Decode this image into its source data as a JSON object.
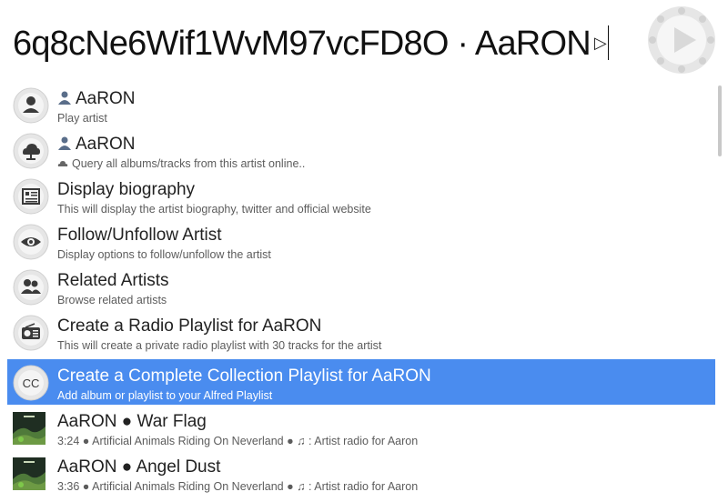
{
  "query": {
    "text": "6q8cNe6Wif1WvM97vcFD8O · AaRON",
    "arrow": "▷"
  },
  "app_logo": "alfred-hat-logo",
  "results": [
    {
      "icon": "person-icon",
      "title": "AaRON",
      "title_icon": "person-mini-icon",
      "subtitle": "Play artist"
    },
    {
      "icon": "cloud-person-icon",
      "title": "AaRON",
      "title_icon": "person-mini-icon",
      "subtitle": "Query all albums/tracks from this artist online..",
      "subtitle_icon": "cloud-mini-icon"
    },
    {
      "icon": "biography-icon",
      "title": "Display biography",
      "subtitle": "This will display the artist biography, twitter and official website"
    },
    {
      "icon": "eye-icon",
      "title": "Follow/Unfollow Artist",
      "subtitle": "Display options to follow/unfollow the artist"
    },
    {
      "icon": "people-icon",
      "title": "Related Artists",
      "subtitle": "Browse related artists"
    },
    {
      "icon": "radio-icon",
      "title": "Create a Radio Playlist for AaRON",
      "subtitle": "This will create a private radio playlist with 30 tracks for the artist"
    },
    {
      "icon": "cc-icon",
      "icon_text": "CC",
      "title": "Create a Complete Collection Playlist for AaRON",
      "subtitle": "Add album or playlist to your Alfred Playlist",
      "selected": true
    },
    {
      "icon": "album-art-icon",
      "title": "AaRON ● War Flag",
      "subtitle": "3:24 ● Artificial Animals Riding On Neverland ● ♫ : Artist radio for Aaron"
    },
    {
      "icon": "album-art-icon",
      "title": "AaRON ● Angel Dust",
      "subtitle": "3:36 ● Artificial Animals Riding On Neverland ● ♫ : Artist radio for Aaron"
    }
  ],
  "colors": {
    "selection": "#4a8cef",
    "icon_circle": "#e8e8e8",
    "icon_dark": "#3a3a3a"
  }
}
